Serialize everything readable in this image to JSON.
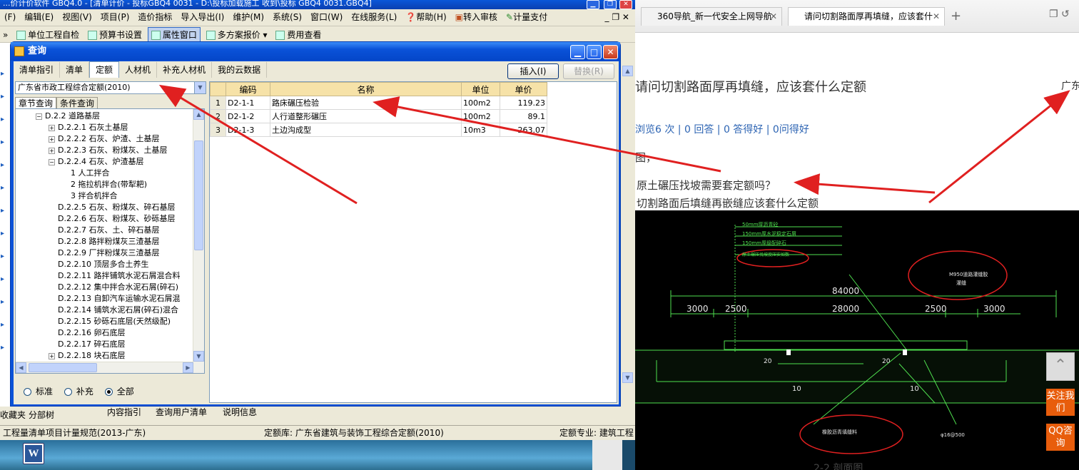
{
  "app": {
    "title": "...价计价软件 GBQ4.0  - [清单计价 - 投标GBQ4 0031 - D:\\投标加载施工 收到\\投标 GBQ4 0031.GBQ4]",
    "menu": [
      "(F)",
      "编辑(E)",
      "视图(V)",
      "项目(P)",
      "造价指标",
      "导入导出(I)",
      "维护(M)",
      "系统(S)",
      "窗口(W)",
      "在线服务(L)",
      "帮助(H)",
      "转入审核",
      "计量支付"
    ],
    "toolbar": [
      "»",
      "单位工程自检",
      "预算书设置",
      "属性窗口",
      "多方案报价 ▾",
      "费用查看"
    ],
    "bottom_tabs": [
      "收藏夹",
      "分部树",
      "内容指引",
      "查询用户清单",
      "说明信息"
    ],
    "status": {
      "left": "工程量清单项目计量规范(2013-广东)",
      "middle": "定额库: 广东省建筑与装饰工程综合定额(2010)",
      "right": "定额专业: 建筑工程"
    }
  },
  "dialog": {
    "title": "查询",
    "tabs": [
      "清单指引",
      "清单",
      "定额",
      "人材机",
      "补充人材机",
      "我的云数据"
    ],
    "selected_tab": "定额",
    "insert_button": "插入(I)",
    "replace_button": "替换(R)",
    "library": "广东省市政工程综合定额(2010)",
    "subtabs": [
      "章节查询",
      "条件查询"
    ],
    "tree": [
      {
        "indent": 0,
        "toggle": "−",
        "label": "D.2.2 道路基层"
      },
      {
        "indent": 1,
        "toggle": "+",
        "label": "D.2.2.1 石灰土基层"
      },
      {
        "indent": 1,
        "toggle": "+",
        "label": "D.2.2.2 石灰、炉渣、土基层"
      },
      {
        "indent": 1,
        "toggle": "+",
        "label": "D.2.2.3 石灰、粉煤灰、土基层"
      },
      {
        "indent": 1,
        "toggle": "−",
        "label": "D.2.2.4 石灰、炉渣基层"
      },
      {
        "indent": 2,
        "toggle": "",
        "label": "1 人工拌合"
      },
      {
        "indent": 2,
        "toggle": "",
        "label": "2 拖拉机拌合(带犁耙)"
      },
      {
        "indent": 2,
        "toggle": "",
        "label": "3 拌合机拌合"
      },
      {
        "indent": 1,
        "toggle": "",
        "label": "D.2.2.5 石灰、粉煤灰、碎石基层"
      },
      {
        "indent": 1,
        "toggle": "",
        "label": "D.2.2.6 石灰、粉煤灰、砂砾基层"
      },
      {
        "indent": 1,
        "toggle": "",
        "label": "D.2.2.7 石灰、土、碎石基层"
      },
      {
        "indent": 1,
        "toggle": "",
        "label": "D.2.2.8 路拌粉煤灰三渣基层"
      },
      {
        "indent": 1,
        "toggle": "",
        "label": "D.2.2.9 厂拌粉煤灰三渣基层"
      },
      {
        "indent": 1,
        "toggle": "",
        "label": "D.2.2.10 顶层多合土养生"
      },
      {
        "indent": 1,
        "toggle": "",
        "label": "D.2.2.11 路拌铺筑水泥石屑混合料"
      },
      {
        "indent": 1,
        "toggle": "",
        "label": "D.2.2.12 集中拌合水泥石屑(碎石)"
      },
      {
        "indent": 1,
        "toggle": "",
        "label": "D.2.2.13 自卸汽车运输水泥石屑混"
      },
      {
        "indent": 1,
        "toggle": "",
        "label": "D.2.2.14 铺筑水泥石屑(碎石)混合"
      },
      {
        "indent": 1,
        "toggle": "",
        "label": "D.2.2.15 砂砾石底层(天然级配)"
      },
      {
        "indent": 1,
        "toggle": "",
        "label": "D.2.2.16 卵石底层"
      },
      {
        "indent": 1,
        "toggle": "",
        "label": "D.2.2.17 碎石底层"
      },
      {
        "indent": 1,
        "toggle": "+",
        "label": "D.2.2.18 块石底层"
      }
    ],
    "filters": [
      "标准",
      "补充",
      "全部"
    ],
    "selected_filter": "全部",
    "columns": [
      "编码",
      "名称",
      "单位",
      "单价"
    ],
    "rows": [
      {
        "n": "1",
        "code": "D2-1-1",
        "name": "路床碾压检验",
        "unit": "100m2",
        "price": "119.23"
      },
      {
        "n": "2",
        "code": "D2-1-2",
        "name": "人行道整形碾压",
        "unit": "100m2",
        "price": "89.1"
      },
      {
        "n": "3",
        "code": "D2-1-3",
        "name": "土边沟成型",
        "unit": "10m3",
        "price": "263.07"
      }
    ]
  },
  "browser": {
    "tabs": [
      "360导航_新一代安全上网导航",
      "请问切割路面厚再填缝，应该套什"
    ],
    "question_title": "请问切割路面厚再填缝，应该套什么定额",
    "region": "广东",
    "meta": "浏览6 次 | 0 回答 | 0 答得好 | 0问得好",
    "lines": [
      "图，",
      "原土碾压找坡需要套定额吗？",
      "切割路面后填缝再嵌缝应该套什么定额"
    ],
    "side_buttons": [
      "关注我们",
      "QQ咨询"
    ]
  },
  "cad": {
    "layer_notes": [
      "50mm厚沥青砼",
      "150mm厚水泥稳定石屑",
      "150mm厚级配碎石",
      "原土碾压找坡度压实如数"
    ],
    "total": "84000",
    "dims": [
      "3000",
      "2500",
      "28000",
      "2500",
      "3000"
    ],
    "callout_top": [
      "M950道路灌缝胶",
      "灌缝"
    ],
    "callout_bottom": "橡胶沥青填缝料",
    "rebar": "φ16@500",
    "dim_small": [
      "10",
      "10",
      "20",
      "20"
    ],
    "section": "2-2 剖面图"
  },
  "colors": {
    "accent": "#0a52d8",
    "annotation": "#e02020",
    "cad_line": "#4fe04f"
  }
}
